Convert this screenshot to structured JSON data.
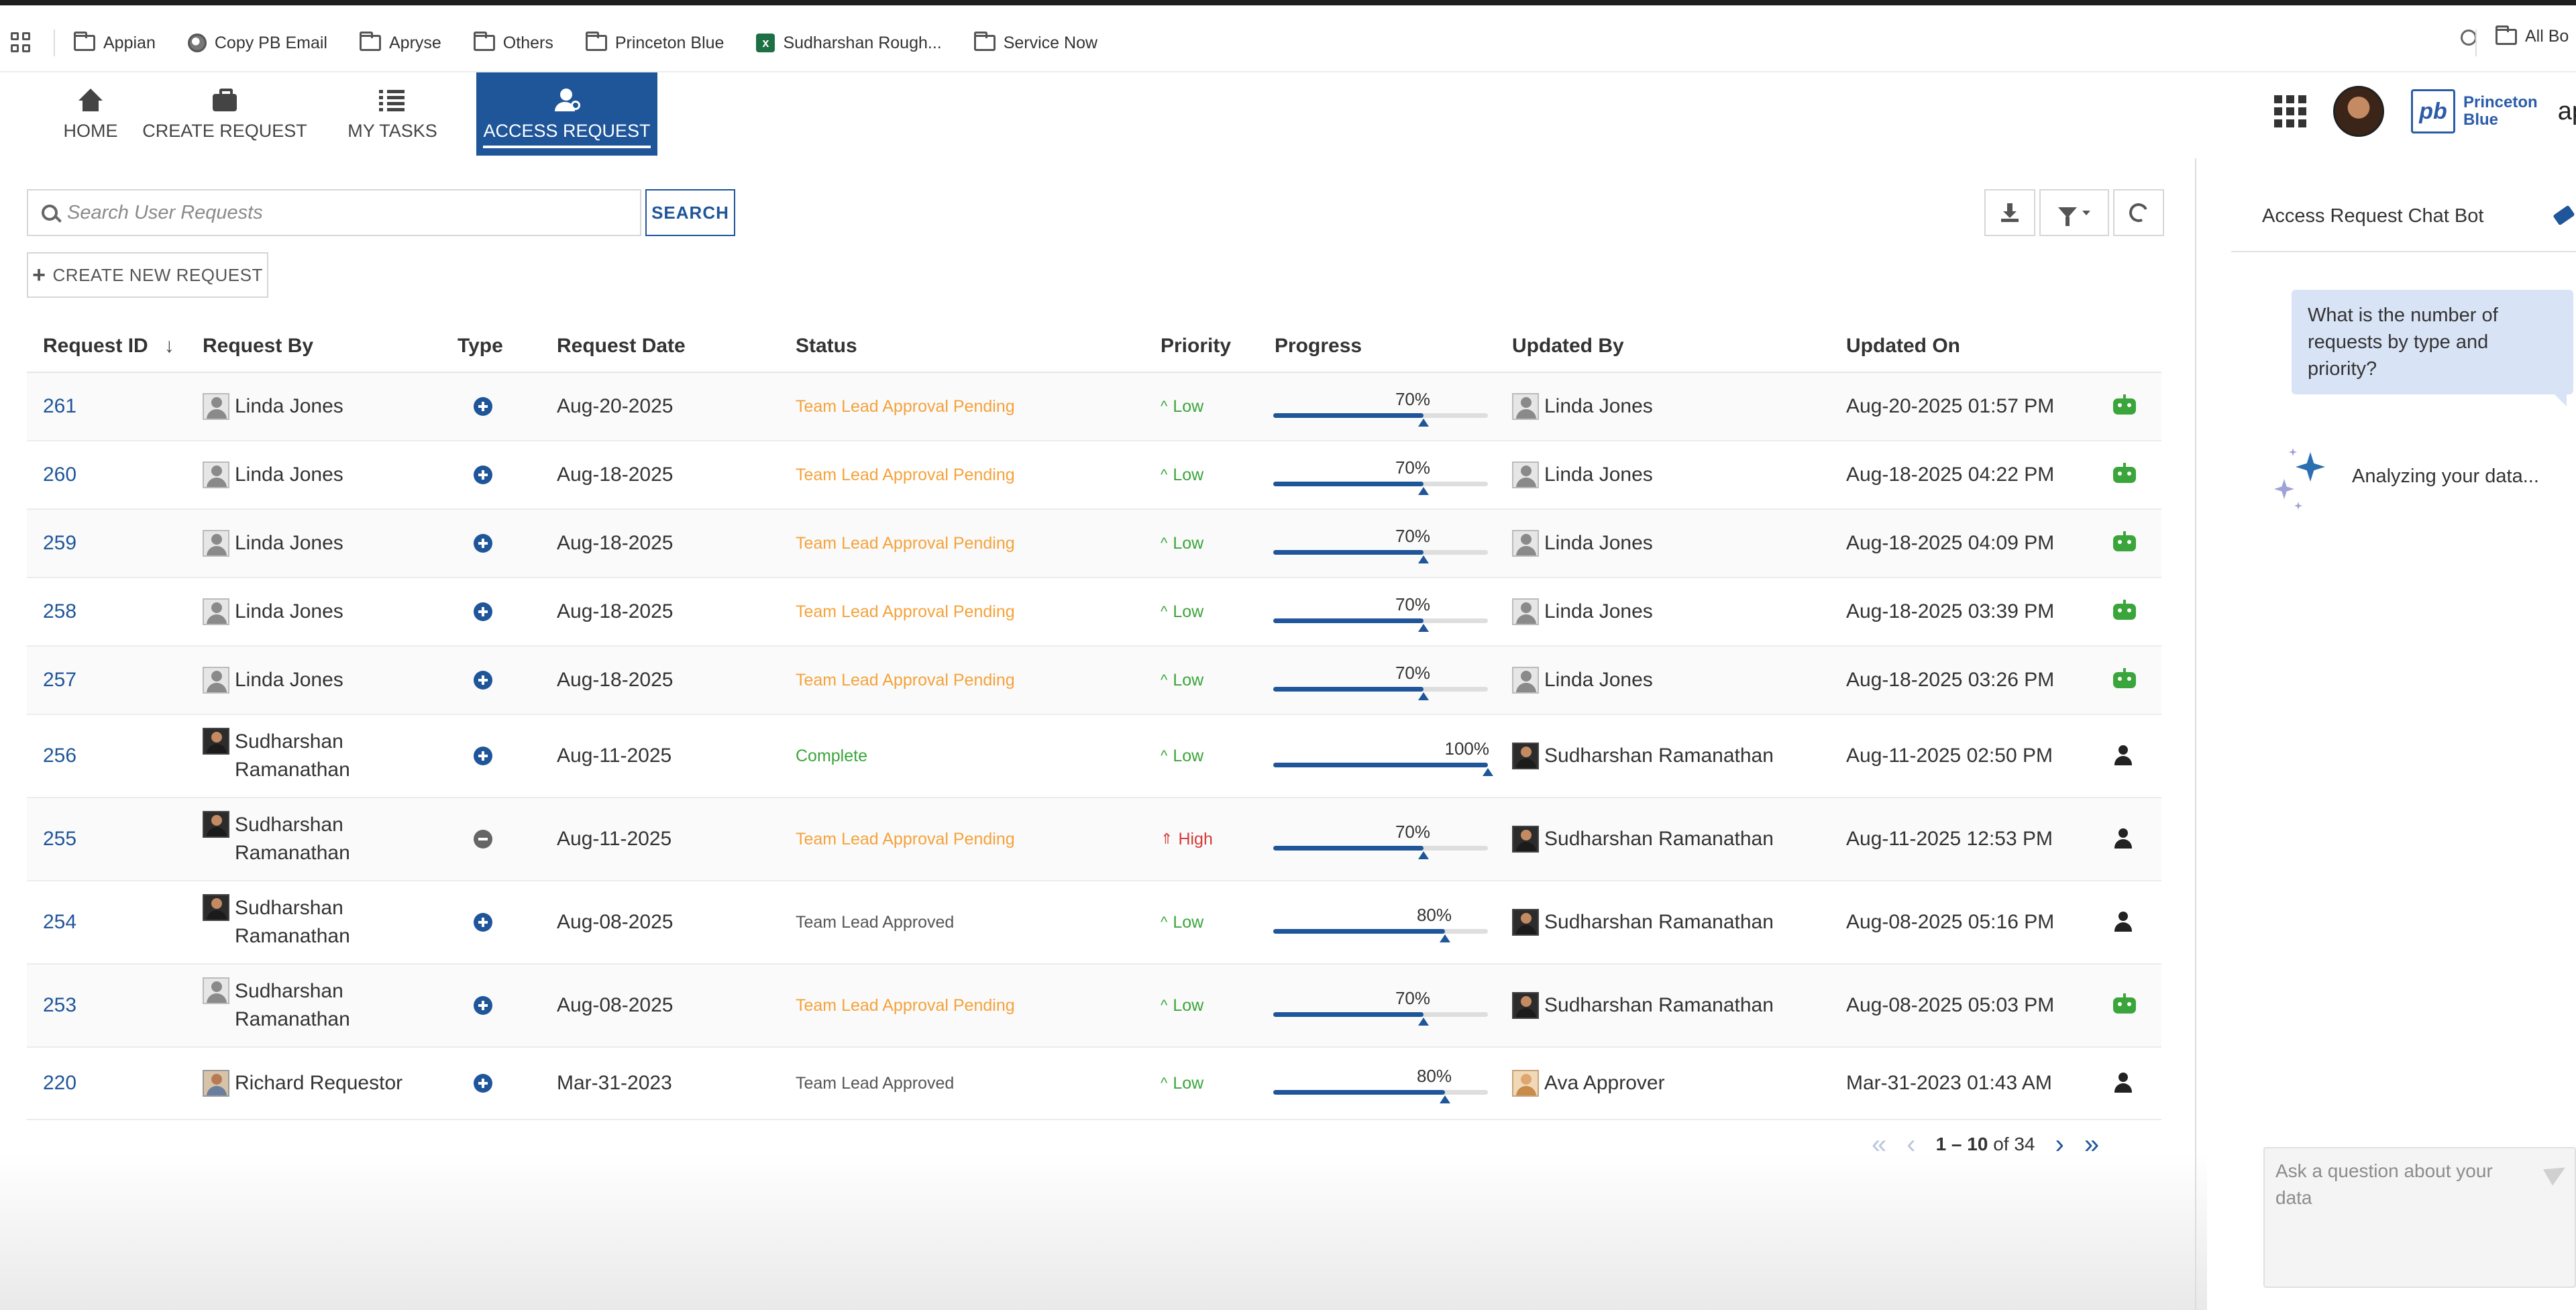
{
  "bookmarks": {
    "items": [
      {
        "label": "Appian",
        "icon": "folder-icon"
      },
      {
        "label": "Copy PB Email",
        "icon": "globe-icon"
      },
      {
        "label": "Apryse",
        "icon": "folder-icon"
      },
      {
        "label": "Others",
        "icon": "folder-icon"
      },
      {
        "label": "Princeton Blue",
        "icon": "folder-icon"
      },
      {
        "label": "Sudharshan Rough...",
        "icon": "excel-icon"
      },
      {
        "label": "Service Now",
        "icon": "folder-icon"
      }
    ],
    "all_label": "All Bo"
  },
  "nav": {
    "tabs": [
      {
        "label": "HOME",
        "icon": "home-icon"
      },
      {
        "label": "CREATE REQUEST",
        "icon": "briefcase-icon"
      },
      {
        "label": "MY TASKS",
        "icon": "list-icon"
      },
      {
        "label": "ACCESS REQUEST",
        "icon": "user-key-icon",
        "active": true
      }
    ],
    "logo_text_1": "Princeton",
    "logo_text_2": "Blue",
    "logo_mark": "pb",
    "cut_text": "ap"
  },
  "toolbar": {
    "search_placeholder": "Search User Requests",
    "search_label": "SEARCH",
    "create_label": "CREATE NEW REQUEST"
  },
  "table": {
    "columns": {
      "id": "Request ID",
      "by": "Request By",
      "type": "Type",
      "date": "Request Date",
      "status": "Status",
      "priority": "Priority",
      "progress": "Progress",
      "updated_by": "Updated By",
      "updated_on": "Updated On"
    },
    "sort_indicator": "↓",
    "rows": [
      {
        "id": "261",
        "by": "Linda Jones",
        "by_av": "default",
        "type": "add",
        "date": "Aug-20-2025",
        "status": "Team Lead Approval Pending",
        "status_kind": "pending",
        "priority": "Low",
        "progress": 70,
        "progress_label": "70%",
        "updated_by": "Linda Jones",
        "upd_av": "default",
        "updated_on": "Aug-20-2025 01:57 PM",
        "actor": "robot"
      },
      {
        "id": "260",
        "by": "Linda Jones",
        "by_av": "default",
        "type": "add",
        "date": "Aug-18-2025",
        "status": "Team Lead Approval Pending",
        "status_kind": "pending",
        "priority": "Low",
        "progress": 70,
        "progress_label": "70%",
        "updated_by": "Linda Jones",
        "upd_av": "default",
        "updated_on": "Aug-18-2025 04:22 PM",
        "actor": "robot"
      },
      {
        "id": "259",
        "by": "Linda Jones",
        "by_av": "default",
        "type": "add",
        "date": "Aug-18-2025",
        "status": "Team Lead Approval Pending",
        "status_kind": "pending",
        "priority": "Low",
        "progress": 70,
        "progress_label": "70%",
        "updated_by": "Linda Jones",
        "upd_av": "default",
        "updated_on": "Aug-18-2025 04:09 PM",
        "actor": "robot"
      },
      {
        "id": "258",
        "by": "Linda Jones",
        "by_av": "default",
        "type": "add",
        "date": "Aug-18-2025",
        "status": "Team Lead Approval Pending",
        "status_kind": "pending",
        "priority": "Low",
        "progress": 70,
        "progress_label": "70%",
        "updated_by": "Linda Jones",
        "upd_av": "default",
        "updated_on": "Aug-18-2025 03:39 PM",
        "actor": "robot"
      },
      {
        "id": "257",
        "by": "Linda Jones",
        "by_av": "default",
        "type": "add",
        "date": "Aug-18-2025",
        "status": "Team Lead Approval Pending",
        "status_kind": "pending",
        "priority": "Low",
        "progress": 70,
        "progress_label": "70%",
        "updated_by": "Linda Jones",
        "upd_av": "default",
        "updated_on": "Aug-18-2025 03:26 PM",
        "actor": "robot"
      },
      {
        "id": "256",
        "by": "Sudharshan Ramanathan",
        "by_av": "photo",
        "type": "add",
        "date": "Aug-11-2025",
        "status": "Complete",
        "status_kind": "complete",
        "priority": "Low",
        "progress": 100,
        "progress_label": "100%",
        "updated_by": "Sudharshan Ramanathan",
        "upd_av": "photo",
        "updated_on": "Aug-11-2025 02:50 PM",
        "actor": "human"
      },
      {
        "id": "255",
        "by": "Sudharshan Ramanathan",
        "by_av": "photo",
        "type": "remove",
        "date": "Aug-11-2025",
        "status": "Team Lead Approval Pending",
        "status_kind": "pending",
        "priority": "High",
        "progress": 70,
        "progress_label": "70%",
        "updated_by": "Sudharshan Ramanathan",
        "upd_av": "photo",
        "updated_on": "Aug-11-2025 12:53 PM",
        "actor": "human"
      },
      {
        "id": "254",
        "by": "Sudharshan Ramanathan",
        "by_av": "photo",
        "type": "add",
        "date": "Aug-08-2025",
        "status": "Team Lead Approved",
        "status_kind": "approved",
        "priority": "Low",
        "progress": 80,
        "progress_label": "80%",
        "updated_by": "Sudharshan Ramanathan",
        "upd_av": "photo",
        "updated_on": "Aug-08-2025 05:16 PM",
        "actor": "human"
      },
      {
        "id": "253",
        "by": "Sudharshan Ramanathan",
        "by_av": "default",
        "type": "add",
        "date": "Aug-08-2025",
        "status": "Team Lead Approval Pending",
        "status_kind": "pending",
        "priority": "Low",
        "progress": 70,
        "progress_label": "70%",
        "updated_by": "Sudharshan Ramanathan",
        "upd_av": "photo",
        "updated_on": "Aug-08-2025 05:03 PM",
        "actor": "robot"
      },
      {
        "id": "220",
        "by": "Richard Requestor",
        "by_av": "photo-a",
        "type": "add",
        "date": "Mar-31-2023",
        "status": "Team Lead Approved",
        "status_kind": "approved",
        "priority": "Low",
        "progress": 80,
        "progress_label": "80%",
        "updated_by": "Ava Approver",
        "upd_av": "photo-b",
        "updated_on": "Mar-31-2023 01:43 AM",
        "actor": "human"
      }
    ]
  },
  "pager": {
    "range": "1 – 10",
    "total_text": "of 34",
    "first": "«",
    "prev": "‹",
    "next": "›",
    "last": "»"
  },
  "chat": {
    "title": "Access Request Chat Bot",
    "user_message": "What is the number of requests by type and priority?",
    "status": "Analyzing your data...",
    "input_placeholder": "Ask a question about your data"
  },
  "colors": {
    "primary": "#1f5599",
    "pending": "#f5a23a",
    "complete": "#3aa53a",
    "high": "#d63b3b"
  }
}
